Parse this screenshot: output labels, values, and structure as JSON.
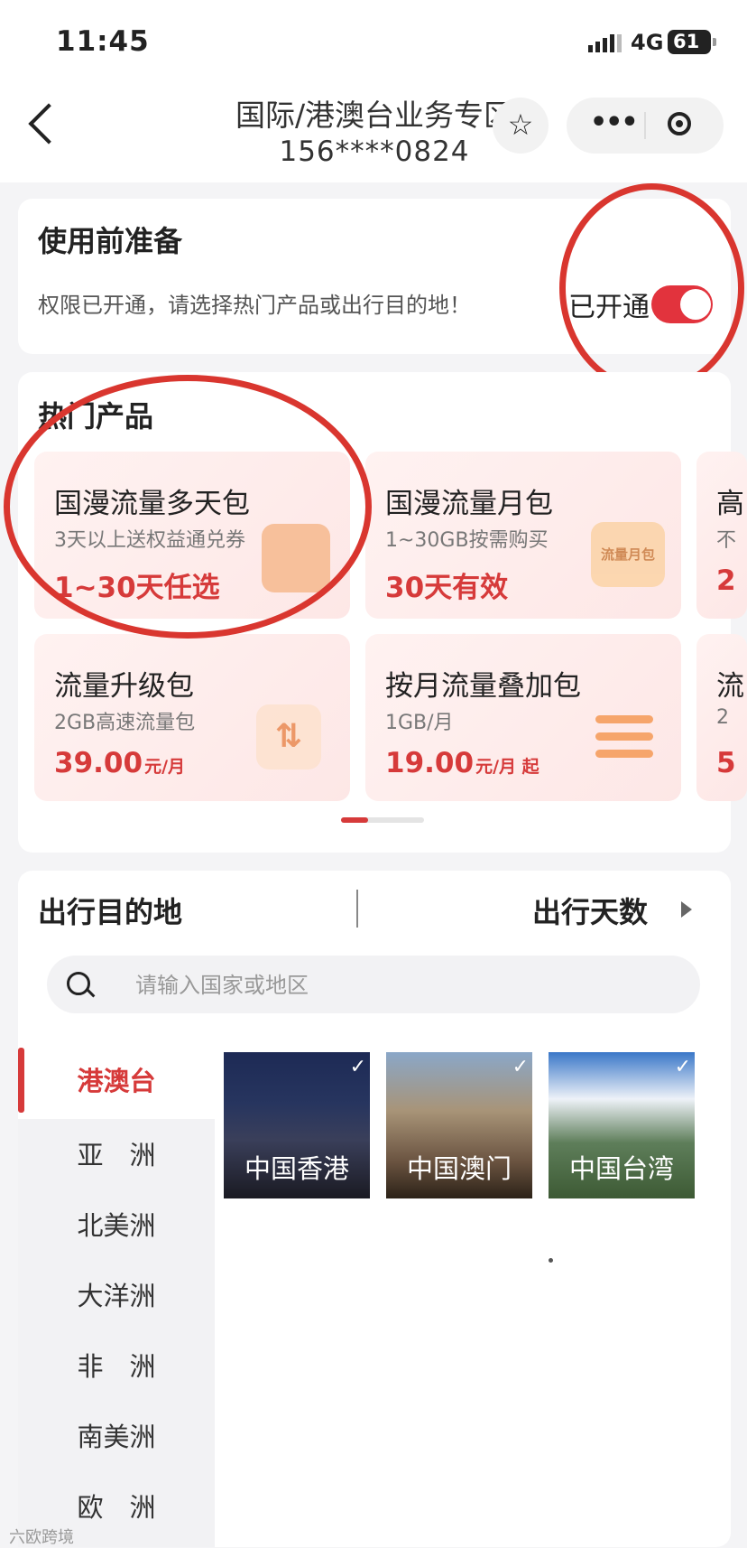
{
  "status_bar": {
    "time": "11:45",
    "network": "4G",
    "battery": "61"
  },
  "header": {
    "title": "国际/港澳台业务专区",
    "phone": "156****0824",
    "star_icon": "star-icon",
    "more_icon": "more-dots-icon",
    "target_icon": "target-icon"
  },
  "prep": {
    "title": "使用前准备",
    "desc": "权限已开通，请选择热门产品或出行目的地！",
    "status": "已开通",
    "enabled": true
  },
  "hot": {
    "title": "热门产品",
    "products": [
      {
        "name": "国漫流量多天包",
        "sub": "3天以上送权益通兑券",
        "price": "1~30天任选",
        "unit": "",
        "icon": "calendar-icon"
      },
      {
        "name": "国漫流量月包",
        "sub": "1~30GB按需购买",
        "price": "30天有效",
        "unit": "",
        "icon": "monthly-pack-icon",
        "icon_text": "流量月包"
      },
      {
        "name": "高",
        "sub": "不",
        "price": "2",
        "unit": "",
        "icon": ""
      },
      {
        "name": "流量升级包",
        "sub": "2GB高速流量包",
        "price": "39.00",
        "unit": "元/月",
        "icon": "upgrade-icon"
      },
      {
        "name": "按月流量叠加包",
        "sub": "1GB/月",
        "price": "19.00",
        "unit": "元/月 起",
        "icon": "stack-icon"
      },
      {
        "name": "流",
        "sub": "2",
        "price": "5",
        "unit": "",
        "icon": ""
      }
    ]
  },
  "destinations": {
    "title": "出行目的地",
    "days_label": "出行天数",
    "search_placeholder": "请输入国家或地区",
    "regions": [
      "港澳台",
      "亚　洲",
      "北美洲",
      "大洋洲",
      "非　洲",
      "南美洲",
      "欧　洲"
    ],
    "active_region": "港澳台",
    "tiles": [
      {
        "label": "中国香港"
      },
      {
        "label": "中国澳门"
      },
      {
        "label": "中国台湾"
      }
    ]
  },
  "watermark": "六欧跨境",
  "colors": {
    "accent": "#d63a3a",
    "toggle_on": "#e2333d",
    "annotation": "#d9362f"
  }
}
